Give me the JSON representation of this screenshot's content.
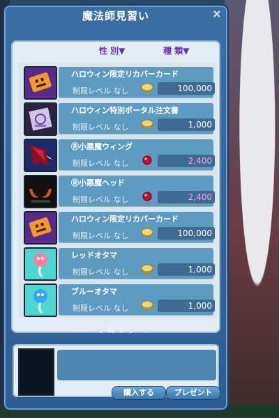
{
  "window": {
    "title": "魔法師見習い",
    "close_label": "×"
  },
  "filters": {
    "gender": "性 別▼",
    "kind": "種 類▼"
  },
  "items": [
    {
      "name": "ハロウィン限定リカバーカード",
      "limit": "制限レベル なし",
      "currency": "coin",
      "price": "100,000",
      "icon": "pumpkin-card-icon"
    },
    {
      "name": "ハロウィン特別ポータル注文書",
      "limit": "制限レベル なし",
      "currency": "coin",
      "price": "1,000",
      "icon": "scroll-icon"
    },
    {
      "name": "Ⓡ小悪魔ウィング",
      "limit": "制限レベル なし",
      "currency": "gem",
      "price": "2,400",
      "icon": "devil-wing-icon"
    },
    {
      "name": "Ⓡ小悪魔ヘッド",
      "limit": "制限レベル なし",
      "currency": "gem",
      "price": "2,400",
      "icon": "devil-horns-icon"
    },
    {
      "name": "ハロウィン限定リカバーカード",
      "limit": "制限レベル なし",
      "currency": "coin",
      "price": "100,000",
      "icon": "pumpkin-card-icon"
    },
    {
      "name": "レッドオタマ",
      "limit": "制限レベル なし",
      "currency": "coin",
      "price": "1,000",
      "icon": "red-tadpole-icon"
    },
    {
      "name": "ブルーオタマ",
      "limit": "制限レベル なし",
      "currency": "coin",
      "price": "1,000",
      "icon": "blue-tadpole-icon"
    }
  ],
  "pager": {
    "current": "2",
    "separator": "/",
    "total": "9",
    "label": "2/ 9"
  },
  "buttons": {
    "buy": "購入する",
    "gift": "プレゼント"
  },
  "colors": {
    "coin": "#e6b84a",
    "gem": "#c4102a",
    "accent": "#6a2fc2"
  }
}
